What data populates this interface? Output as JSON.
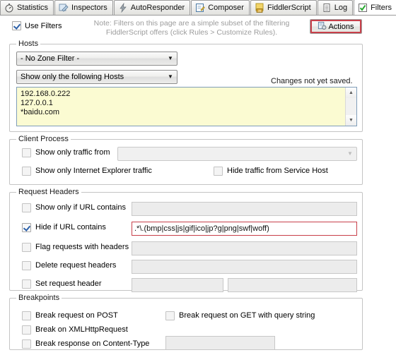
{
  "tabs": [
    {
      "label": "Statistics",
      "icon": "stopwatch-icon",
      "active": false
    },
    {
      "label": "Inspectors",
      "icon": "inspector-icon",
      "active": false
    },
    {
      "label": "AutoResponder",
      "icon": "lightning-icon",
      "active": false
    },
    {
      "label": "Composer",
      "icon": "notepad-pencil-icon",
      "active": false
    },
    {
      "label": "FiddlerScript",
      "icon": "js-script-icon",
      "active": false
    },
    {
      "label": "Log",
      "icon": "document-icon",
      "active": false
    },
    {
      "label": "Filters",
      "icon": "green-check-icon",
      "active": true
    }
  ],
  "top": {
    "use_filters_label": "Use Filters",
    "use_filters_checked": true,
    "note_line1": "Note: Filters on this page are a simple subset of the filtering",
    "note_line2": "FiddlerScript offers (click Rules > Customize Rules).",
    "actions_label": "Actions",
    "actions_icon": "actions-gear-icon"
  },
  "hosts": {
    "legend": "Hosts",
    "zone_filter_value": "- No Zone Filter -",
    "host_mode_value": "Show only the following Hosts",
    "host_list": "192.168.0.222\n127.0.0.1\n*baidu.com",
    "status_text": "Changes not yet saved.",
    "scroll_up_icon": "triangle-up-icon",
    "scroll_down_icon": "triangle-down-icon"
  },
  "client_process": {
    "legend": "Client Process",
    "show_only_traffic_from_label": "Show only traffic from",
    "show_only_traffic_from_checked": false,
    "process_combo_value": "",
    "show_only_ie_label": "Show only Internet Explorer traffic",
    "show_only_ie_checked": false,
    "hide_service_host_label": "Hide traffic from Service Host",
    "hide_service_host_checked": false
  },
  "request_headers": {
    "legend": "Request Headers",
    "rows": [
      {
        "label": "Show only if URL contains",
        "checked": false,
        "value": ""
      },
      {
        "label": "Hide if URL contains",
        "checked": true,
        "value": ".*\\.(bmp|css|js|gif|ico|jp?g|png|swf|woff)"
      },
      {
        "label": "Flag requests with headers",
        "checked": false,
        "value": ""
      },
      {
        "label": "Delete request headers",
        "checked": false,
        "value": ""
      },
      {
        "label": "Set request header",
        "checked": false,
        "value": "",
        "value2": ""
      }
    ]
  },
  "breakpoints": {
    "legend": "Breakpoints",
    "break_post_label": "Break request on POST",
    "break_post_checked": false,
    "break_get_label": "Break request on GET with query string",
    "break_get_checked": false,
    "break_xhr_label": "Break on XMLHttpRequest",
    "break_xhr_checked": false,
    "break_response_label": "Break response on Content-Type",
    "break_response_checked": false,
    "break_response_value": ""
  },
  "colors": {
    "highlight_red": "#c8404a",
    "host_list_bg": "#fbfbd2",
    "check_blue": "#2b5fa8",
    "active_tab_bg": "#ffffff"
  }
}
